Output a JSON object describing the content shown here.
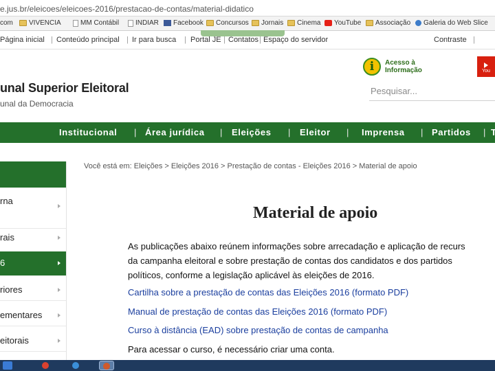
{
  "browser": {
    "url": "e.jus.br/eleicoes/eleicoes-2016/prestacao-de-contas/material-didatico",
    "bookmarks": [
      {
        "label": "com",
        "icon": "page-icon"
      },
      {
        "label": "VIVENCIA",
        "icon": "folder-icon"
      },
      {
        "label": "MM Contábil",
        "icon": "page-icon"
      },
      {
        "label": "INDIAR",
        "icon": "page-icon"
      },
      {
        "label": "Facebook",
        "icon": "facebook-icon"
      },
      {
        "label": "Concursos",
        "icon": "folder-icon"
      },
      {
        "label": "Jornais",
        "icon": "folder-icon"
      },
      {
        "label": "Cinema",
        "icon": "folder-icon"
      },
      {
        "label": "YouTube",
        "icon": "youtube-icon"
      },
      {
        "label": "Associação",
        "icon": "folder-icon"
      },
      {
        "label": "Galeria do Web Slice",
        "icon": "globe-icon"
      }
    ]
  },
  "accessibility_bar": {
    "links": [
      "Página inicial",
      "Conteúdo principal",
      "Ir para busca",
      "Portal JE",
      "Contatos",
      "Espaço do servidor"
    ],
    "contrast": "Contraste",
    "slash": "|"
  },
  "header": {
    "title": "unal Superior Eleitoral",
    "subtitle": "unal da Democracia",
    "acesso_line1": "Acesso à",
    "acesso_line2": "Informação",
    "acesso_i": "i",
    "youtube_label": "You",
    "search_placeholder": "Pesquisar..."
  },
  "main_nav": {
    "items": [
      "Institucional",
      "Área jurídica",
      "Eleições",
      "Eleitor",
      "Imprensa",
      "Partidos",
      "T"
    ],
    "separator": "|"
  },
  "sidebar": {
    "items": [
      {
        "label": "rna",
        "active": false
      },
      {
        "label": "rais",
        "active": false
      },
      {
        "label": "6",
        "active": true
      },
      {
        "label": "riores",
        "active": false
      },
      {
        "label": "ementares",
        "active": false
      },
      {
        "label": "eitorais",
        "active": false
      }
    ]
  },
  "content": {
    "breadcrumb": "Você está em: Eleições > Eleições 2016 > Prestação de contas - Eleições 2016 > Material de apoio",
    "title": "Material de apoio",
    "intro_lines": [
      "As publicações abaixo reúnem informações sobre arrecadação e aplicação de recurs",
      "da campanha eleitoral e sobre prestação de contas dos candidatos e dos partidos",
      "políticos, conforme a legislação aplicável às eleições de 2016."
    ],
    "links": [
      "Cartilha sobre a prestação de contas das Eleições 2016 (formato PDF)",
      "Manual de prestação de contas das Eleições 2016 (formato PDF)",
      "Curso à distância (EAD) sobre prestação de contas de campanha"
    ],
    "note": "Para acessar o curso, é necessário criar uma conta."
  },
  "colors": {
    "brand_green": "#24702b",
    "link_blue": "#1a3e9e",
    "taskbar": "#1f3a5e"
  }
}
